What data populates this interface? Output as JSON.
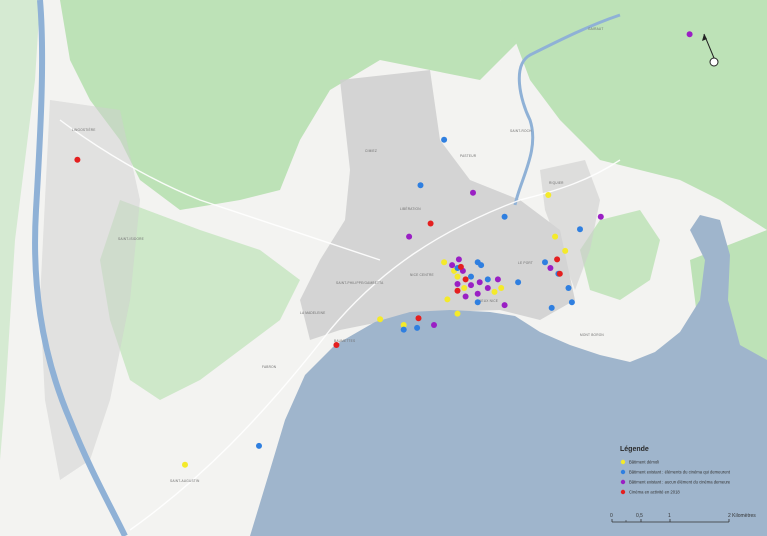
{
  "legend": {
    "title": "Légende",
    "items": [
      {
        "label": "Bâtiment démoli",
        "color": "#f4ea2a"
      },
      {
        "label": "Bâtiment existant : éléments du cinéma qui demeurent",
        "color": "#2f7fe0"
      },
      {
        "label": "Bâtiment existant : aucun élément du cinéma demeure",
        "color": "#9a1fc4"
      },
      {
        "label": "Cinéma en activité en 2018",
        "color": "#e41f1f"
      }
    ]
  },
  "scale": {
    "ticks": [
      "0",
      "0,5",
      "1",
      "2 Kilomètres"
    ]
  },
  "north_arrow": {
    "icon": "north-arrow-icon"
  },
  "places": [
    "LINGOSTIÈRE",
    "SAINT-ISIDORE",
    "LA MADELEINE",
    "FABRON",
    "SAINT-AUGUSTIN",
    "CIMIEZ",
    "LIBÉRATION",
    "SAINT-PHILIPPE/GAMBETTA",
    "NICE CENTRE",
    "VIEUX NICE",
    "LE PORT",
    "RIQUIER",
    "SAINT-ROCH",
    "PASTEUR",
    "GAIRAUT",
    "MONT BORON",
    "BAUMETTES"
  ],
  "colors": {
    "land": "#f3f3f1",
    "green": "#b7e0b0",
    "sea": "#9fb5cc",
    "river": "#8fb1d6",
    "city": "#cfcfcf"
  },
  "cinemas": [
    {
      "cat": "demolished",
      "lon": 7.2795,
      "lat": 43.7178
    },
    {
      "cat": "demolished",
      "lon": 7.2805,
      "lat": 43.7105
    },
    {
      "cat": "demolished",
      "lon": 7.2715,
      "lat": 43.7008
    },
    {
      "cat": "demolished",
      "lon": 7.258,
      "lat": 43.695
    },
    {
      "cat": "demolished",
      "lon": 7.2255,
      "lat": 43.6705
    },
    {
      "cat": "demolished",
      "lon": 7.2545,
      "lat": 43.696
    },
    {
      "cat": "demolished",
      "lon": 7.2655,
      "lat": 43.7045
    },
    {
      "cat": "demolished",
      "lon": 7.264,
      "lat": 43.706
    },
    {
      "cat": "demolished",
      "lon": 7.266,
      "lat": 43.697
    },
    {
      "cat": "demolished",
      "lon": 7.2725,
      "lat": 43.7015
    },
    {
      "cat": "demolished",
      "lon": 7.282,
      "lat": 43.708
    },
    {
      "cat": "demolished",
      "lon": 7.266,
      "lat": 43.7035
    },
    {
      "cat": "demolished",
      "lon": 7.267,
      "lat": 43.7015
    },
    {
      "cat": "demolished",
      "lon": 7.2645,
      "lat": 43.6995
    },
    {
      "cat": "existing_remains",
      "lon": 7.264,
      "lat": 43.7275
    },
    {
      "cat": "existing_remains",
      "lon": 7.2605,
      "lat": 43.7195
    },
    {
      "cat": "existing_remains",
      "lon": 7.273,
      "lat": 43.714
    },
    {
      "cat": "existing_remains",
      "lon": 7.266,
      "lat": 43.705
    },
    {
      "cat": "existing_remains",
      "lon": 7.2695,
      "lat": 43.7055
    },
    {
      "cat": "existing_remains",
      "lon": 7.268,
      "lat": 43.7035
    },
    {
      "cat": "existing_remains",
      "lon": 7.2705,
      "lat": 43.703
    },
    {
      "cat": "existing_remains",
      "lon": 7.275,
      "lat": 43.7025
    },
    {
      "cat": "existing_remains",
      "lon": 7.279,
      "lat": 43.706
    },
    {
      "cat": "existing_remains",
      "lon": 7.281,
      "lat": 43.704
    },
    {
      "cat": "existing_remains",
      "lon": 7.2825,
      "lat": 43.7015
    },
    {
      "cat": "existing_remains",
      "lon": 7.283,
      "lat": 43.699
    },
    {
      "cat": "existing_remains",
      "lon": 7.28,
      "lat": 43.698
    },
    {
      "cat": "existing_remains",
      "lon": 7.26,
      "lat": 43.6945
    },
    {
      "cat": "existing_remains",
      "lon": 7.258,
      "lat": 43.6942
    },
    {
      "cat": "existing_remains",
      "lon": 7.2365,
      "lat": 43.6738
    },
    {
      "cat": "existing_remains",
      "lon": 7.2842,
      "lat": 43.7118
    },
    {
      "cat": "existing_remains",
      "lon": 7.269,
      "lat": 43.699
    },
    {
      "cat": "existing_remains",
      "lon": 7.269,
      "lat": 43.706
    },
    {
      "cat": "no_remains",
      "lon": 7.3005,
      "lat": 43.746
    },
    {
      "cat": "no_remains",
      "lon": 7.2683,
      "lat": 43.7182
    },
    {
      "cat": "no_remains",
      "lon": 7.2873,
      "lat": 43.714
    },
    {
      "cat": "no_remains",
      "lon": 7.2588,
      "lat": 43.7105
    },
    {
      "cat": "no_remains",
      "lon": 7.2662,
      "lat": 43.7065
    },
    {
      "cat": "no_remains",
      "lon": 7.2668,
      "lat": 43.7045
    },
    {
      "cat": "no_remains",
      "lon": 7.268,
      "lat": 43.702
    },
    {
      "cat": "no_remains",
      "lon": 7.2693,
      "lat": 43.7025
    },
    {
      "cat": "no_remains",
      "lon": 7.2705,
      "lat": 43.7015
    },
    {
      "cat": "no_remains",
      "lon": 7.272,
      "lat": 43.703
    },
    {
      "cat": "no_remains",
      "lon": 7.269,
      "lat": 43.7005
    },
    {
      "cat": "no_remains",
      "lon": 7.2672,
      "lat": 43.7
    },
    {
      "cat": "no_remains",
      "lon": 7.273,
      "lat": 43.6985
    },
    {
      "cat": "no_remains",
      "lon": 7.2625,
      "lat": 43.695
    },
    {
      "cat": "no_remains",
      "lon": 7.2798,
      "lat": 43.705
    },
    {
      "cat": "no_remains",
      "lon": 7.2652,
      "lat": 43.7055
    },
    {
      "cat": "no_remains",
      "lon": 7.266,
      "lat": 43.7022
    },
    {
      "cat": "active_2018",
      "lon": 7.2095,
      "lat": 43.724
    },
    {
      "cat": "active_2018",
      "lon": 7.262,
      "lat": 43.7128
    },
    {
      "cat": "active_2018",
      "lon": 7.2665,
      "lat": 43.7052
    },
    {
      "cat": "active_2018",
      "lon": 7.2672,
      "lat": 43.703
    },
    {
      "cat": "active_2018",
      "lon": 7.266,
      "lat": 43.701
    },
    {
      "cat": "active_2018",
      "lon": 7.2808,
      "lat": 43.7065
    },
    {
      "cat": "active_2018",
      "lon": 7.2812,
      "lat": 43.704
    },
    {
      "cat": "active_2018",
      "lon": 7.2602,
      "lat": 43.6962
    },
    {
      "cat": "active_2018",
      "lon": 7.248,
      "lat": 43.6915
    }
  ]
}
